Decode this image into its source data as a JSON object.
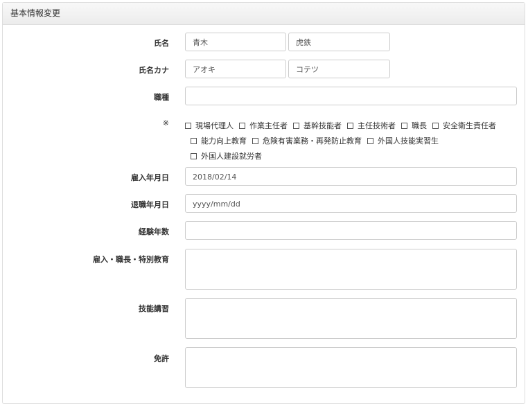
{
  "panel": {
    "title": "基本情報変更"
  },
  "fields": {
    "name": {
      "label": "氏名",
      "last": "青木",
      "first": "虎鉄"
    },
    "kana": {
      "label": "氏名カナ",
      "last": "アオキ",
      "first": "コテツ"
    },
    "job_type": {
      "label": "職種",
      "value": ""
    },
    "qualifications": {
      "label": "※",
      "options": [
        "現場代理人",
        "作業主任者",
        "基幹技能者",
        "主任技術者",
        "職長",
        "安全衛生責任者",
        "能力向上教育",
        "危険有害業務・再発防止教育",
        "外国人技能実習生",
        "外国人建設就労者"
      ]
    },
    "hire_date": {
      "label": "雇入年月日",
      "value": "2018/02/14"
    },
    "retire_date": {
      "label": "退職年月日",
      "placeholder": "yyyy/mm/dd"
    },
    "experience_years": {
      "label": "経験年数",
      "value": ""
    },
    "special_education": {
      "label": "雇入・職長・特別教育"
    },
    "skill_training": {
      "label": "技能講習"
    },
    "license": {
      "label": "免許"
    }
  }
}
